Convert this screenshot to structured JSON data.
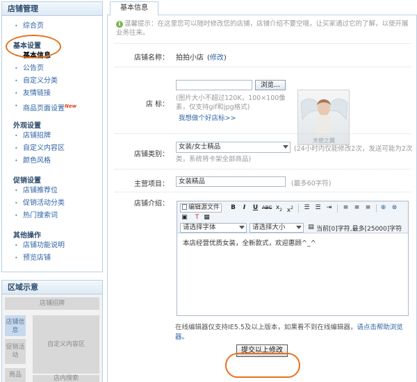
{
  "sidebar": {
    "store_panel_title": "店铺管理",
    "groups": [
      {
        "title": "",
        "items": [
          {
            "label": "综合页"
          }
        ]
      },
      {
        "title": "基本设置",
        "items": [
          {
            "label": "基本信息"
          },
          {
            "label": "公告页"
          },
          {
            "label": "自定义分类"
          },
          {
            "label": "友情链接"
          },
          {
            "label": "商品页面设置",
            "badge": "New"
          }
        ]
      },
      {
        "title": "外观设置",
        "items": [
          {
            "label": "店铺招牌"
          },
          {
            "label": "自定义内容区"
          },
          {
            "label": "颜色风格"
          }
        ]
      },
      {
        "title": "促销设置",
        "items": [
          {
            "label": "店铺推荐位"
          },
          {
            "label": "促销活动分类"
          },
          {
            "label": "热门搜索词"
          }
        ]
      },
      {
        "title": "其他操作",
        "items": [
          {
            "label": "店铺功能说明"
          },
          {
            "label": "预览店铺"
          }
        ]
      }
    ],
    "region_panel_title": "区域示意",
    "region": {
      "banner": "店铺招牌",
      "store_info": "店铺信息",
      "promo": "促销活动",
      "custom": "自定义内容区",
      "search": "店内搜索",
      "goods": "商品"
    }
  },
  "tab": {
    "label": "基本信息"
  },
  "notice": "温馨提示：在这里您可以随时修改您的店铺，店铺介绍不要空哦，让买家通过它的了解，以便开展业务往来。",
  "store_name": {
    "label": "店铺名称：",
    "value": "拍拍小店",
    "edit_link": "修改"
  },
  "logo": {
    "label": "店 标：",
    "browse_button": "浏览...",
    "hint_line1": "(图片大小不超过120K，100×100像",
    "hint_line2": "素，仅支持gif和jpg格式)",
    "help_link": "我想做个好店标>>",
    "watermark": "天使之翼"
  },
  "category": {
    "label": "店铺类别：",
    "selected": "女装/女士精品",
    "hint_line1": "(24小时内仅能修改2次，发送可能为2次",
    "hint_line2": "类，系统将卡架全部商品)"
  },
  "main_project": {
    "label": "主营项目：",
    "value": "女装精品",
    "hint": "(最多60字符)"
  },
  "intro": {
    "label": "店铺介绍：",
    "toolbar": {
      "source_button": "编辑源文件",
      "font_select": "请选择字体",
      "size_select": "请选择大小",
      "counter": "当前[0]字符,最多[25000]字符"
    },
    "content": "本店经营优质女装，全新款式，欢迎惠顾^_^",
    "footer_line1": "在线编辑器仅支持IE5.5及以上版本，如果看不到在线编辑器，",
    "footer_link": "请点击帮助浏览器。"
  },
  "submit_button": "提交以上修改"
}
